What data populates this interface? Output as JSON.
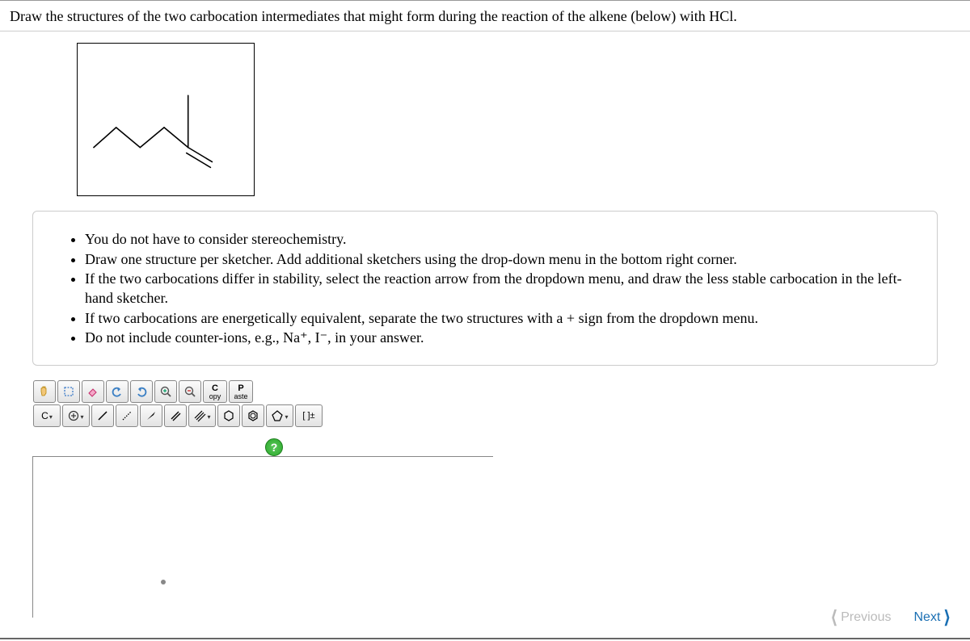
{
  "question": "Draw the structures of the two carbocation intermediates that might form during the reaction of the alkene (below) with HCl.",
  "instructions": {
    "items": [
      "You do not have to consider stereochemistry.",
      "Draw one structure per sketcher. Add additional sketchers using the drop-down menu in the bottom right corner.",
      "If the two carbocations differ in stability, select the reaction arrow from the dropdown menu, and draw the less stable carbocation in the left-hand sketcher.",
      "If two carbocations are energetically equivalent, separate the two structures with a + sign from the dropdown menu.",
      "Do not include counter-ions, e.g., Na⁺, I⁻, in your answer."
    ]
  },
  "toolbar1": {
    "hand": "✋",
    "lasso": "⬚",
    "eraser": "◪",
    "undo": "↶",
    "redo": "↷",
    "zoomIn": "+",
    "zoomOut": "−",
    "copy": {
      "line1": "C",
      "line2": "opy"
    },
    "paste": {
      "line1": "P",
      "line2": "aste"
    }
  },
  "toolbar2": {
    "element": "C",
    "charge": "⊕",
    "single": "/",
    "dashed": "⋰",
    "wedge": "◢",
    "double": "//",
    "triple": "///",
    "hex": "⬡",
    "benz": "⬢",
    "pent": "⬠",
    "bracket": "[ ]±"
  },
  "help": "?",
  "nav": {
    "prev": "Previous",
    "next": "Next"
  }
}
